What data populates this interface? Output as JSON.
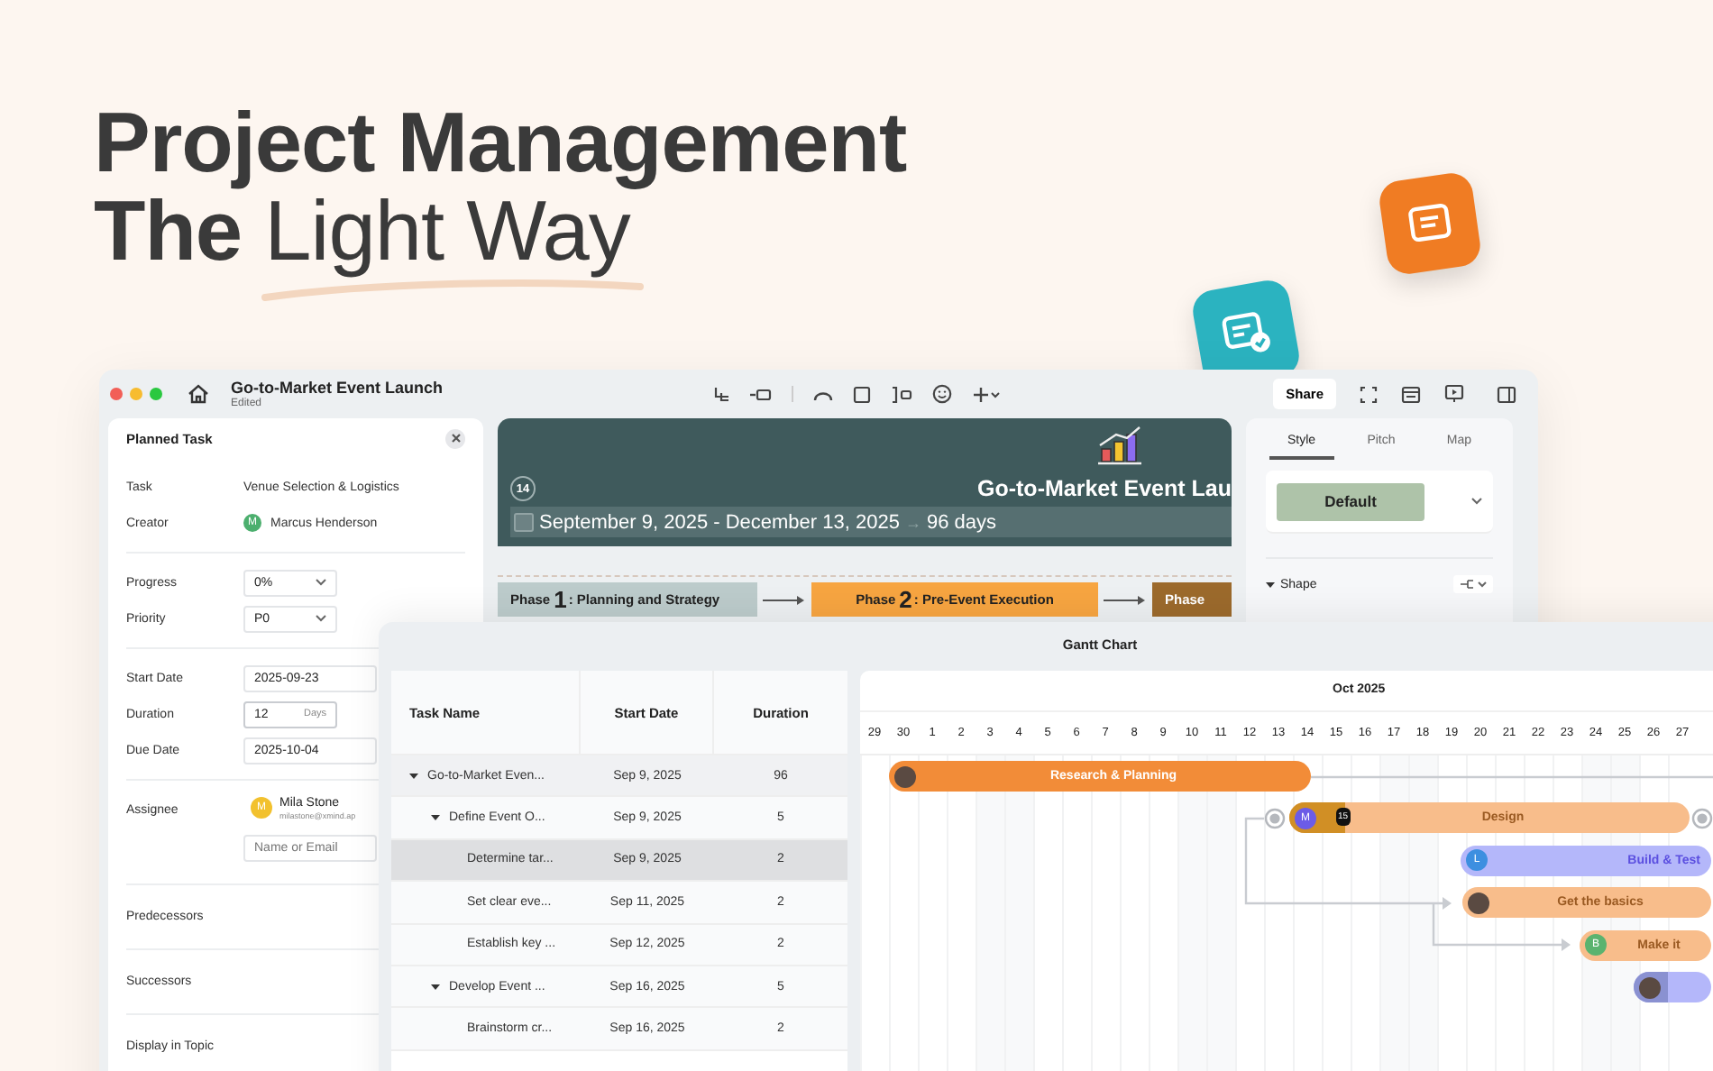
{
  "headline": {
    "line1": "Project Management",
    "line2": "**The** Light Way"
  },
  "window": {
    "title": "Go-to-Market Event Launch",
    "status": "Edited",
    "share": "Share"
  },
  "task_panel": {
    "title": "Planned Task",
    "sections": [
      [
        {
          "kind": "text",
          "label": "Task",
          "value": "Venue Selection & Logistics"
        },
        {
          "kind": "person",
          "label": "Creator",
          "initial": "M",
          "name": "Marcus Henderson",
          "color": "#4caf6e"
        }
      ],
      [
        {
          "kind": "select",
          "label": "Progress",
          "value": "0%"
        },
        {
          "kind": "select",
          "label": "Priority",
          "value": "P0"
        }
      ],
      [
        {
          "kind": "input",
          "label": "Start Date",
          "value": "2025-09-23"
        },
        {
          "kind": "duration",
          "label": "Duration",
          "value": "12",
          "unit": "Days"
        },
        {
          "kind": "input",
          "label": "Due Date",
          "value": "2025-10-04"
        }
      ],
      [
        {
          "kind": "assignee",
          "label": "Assignee",
          "initial": "M",
          "name": "Mila Stone",
          "email": "milastone@xmind.ap",
          "color": "#f2c12e",
          "placeholder": "Name or Email"
        }
      ],
      [
        {
          "kind": "empty",
          "label": "Predecessors"
        }
      ],
      [
        {
          "kind": "empty",
          "label": "Successors"
        }
      ],
      [
        {
          "kind": "empty",
          "label": "Display in Topic"
        }
      ]
    ]
  },
  "canvas": {
    "banner": {
      "count": "14",
      "title": "Go-to-Market Event Lau",
      "dates": "September 9, 2025 - December 13, 2025",
      "arrow": "→",
      "days": "96 days"
    },
    "phases": [
      {
        "word": "Phase",
        "number": "1",
        "title": ": Planning and Strategy",
        "color": "#bccbcb"
      },
      {
        "word": "Phase",
        "number": "2",
        "title": ": Pre-Event Execution",
        "color": "#f7a541"
      },
      {
        "word": "Phase",
        "color": "#9c6a2c"
      }
    ]
  },
  "style_panel": {
    "tabs": [
      {
        "label": "Style",
        "selected": true
      },
      {
        "label": "Pitch",
        "selected": false
      },
      {
        "label": "Map",
        "selected": false
      }
    ],
    "preset": "Default",
    "section": {
      "label": "Shape",
      "expanded": true
    }
  },
  "gantt": {
    "title": "Gantt Chart",
    "columns": [
      "Task Name",
      "Start Date",
      "Duration"
    ],
    "rows": [
      {
        "name": "Go-to-Market Even...",
        "start": "Sep 9, 2025",
        "duration": "96",
        "selected": false,
        "expanded": true,
        "children": [
          {
            "name": "Define Event O...",
            "start": "Sep 9, 2025",
            "duration": "5",
            "selected": false,
            "expanded": true,
            "children": [
              {
                "name": "Determine tar...",
                "start": "Sep 9, 2025",
                "duration": "2",
                "selected": true
              },
              {
                "name": "Set clear eve...",
                "start": "Sep 11, 2025",
                "duration": "2",
                "selected": false
              },
              {
                "name": "Establish key ...",
                "start": "Sep 12, 2025",
                "duration": "2",
                "selected": false
              }
            ]
          },
          {
            "name": "Develop Event ...",
            "start": "Sep 16, 2025",
            "duration": "5",
            "selected": false,
            "expanded": true,
            "children": [
              {
                "name": "Brainstorm cr...",
                "start": "Sep 16, 2025",
                "duration": "2",
                "selected": false
              }
            ]
          }
        ]
      }
    ],
    "month": "Oct 2025",
    "days": [
      "29",
      "30",
      "1",
      "2",
      "3",
      "4",
      "5",
      "6",
      "7",
      "8",
      "9",
      "10",
      "11",
      "12",
      "13",
      "14",
      "15",
      "16",
      "17",
      "18",
      "19",
      "20",
      "21",
      "22",
      "23",
      "24",
      "25",
      "26",
      "27"
    ],
    "bars": [
      {
        "label": "Research & Planning",
        "avatar": {
          "kind": "photo"
        },
        "color": "#f28c38"
      },
      {
        "label": "Design",
        "avatar": {
          "kind": "initial",
          "initial": "M",
          "color": "#6c5ce7"
        },
        "color": "#f8bd8b",
        "level": 0.14,
        "tooltip": "15"
      },
      {
        "label": "Build & Test",
        "avatar": {
          "kind": "initial",
          "initial": "L",
          "color": "#3d8fe0"
        },
        "color": "#b4b7fa"
      },
      {
        "label": "Get the basics",
        "avatar": {
          "kind": "photo"
        },
        "color": "#f8bd8b"
      },
      {
        "label": "Make it",
        "avatar": {
          "kind": "initial",
          "initial": "B",
          "color": "#5bb36f"
        },
        "color": "#f8bd8b"
      },
      {
        "avatar": {
          "kind": "photo"
        },
        "color": "#b4b7fa",
        "level": 0.45
      }
    ]
  }
}
